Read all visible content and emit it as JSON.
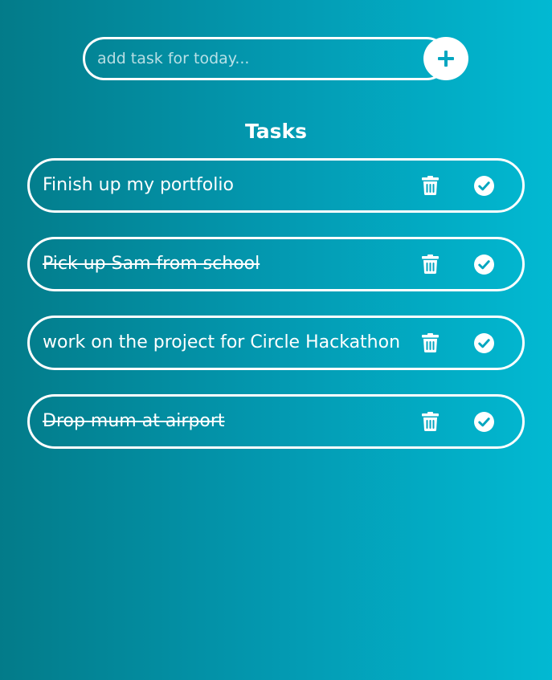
{
  "add_task": {
    "placeholder": "add task for today...",
    "value": "",
    "add_icon": "plus-icon"
  },
  "heading": "Tasks",
  "tasks": [
    {
      "text": "Finish up my portfolio",
      "done": false,
      "delete_icon": "trash-icon",
      "complete_icon": "check-circle-icon"
    },
    {
      "text": "Pick up Sam from school",
      "done": true,
      "delete_icon": "trash-icon",
      "complete_icon": "check-circle-icon"
    },
    {
      "text": "work on the project for Circle Hackathon",
      "done": false,
      "delete_icon": "trash-icon",
      "complete_icon": "check-circle-icon"
    },
    {
      "text": "Drop mum at airport",
      "done": true,
      "delete_icon": "trash-icon",
      "complete_icon": "check-circle-icon"
    }
  ],
  "colors": {
    "gradient_start": "#037b89",
    "gradient_end": "#02b9d2",
    "accent": "#02a6c0",
    "foreground": "#ffffff"
  }
}
